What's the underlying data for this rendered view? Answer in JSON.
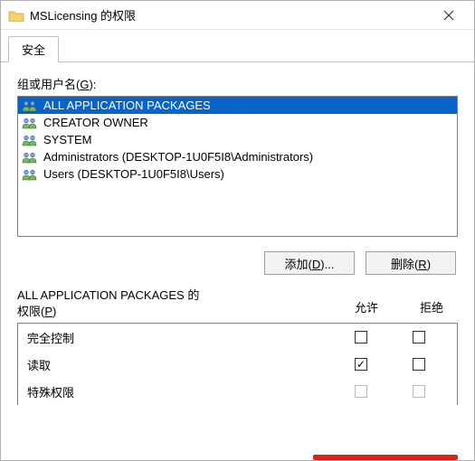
{
  "window": {
    "title": "MSLicensing 的权限"
  },
  "tabs": {
    "security": "安全"
  },
  "labels": {
    "groups_label_pre": "组或用户名(",
    "groups_hotkey": "G",
    "groups_label_post": "):",
    "add_pre": "添加(",
    "add_hotkey": "D",
    "add_post": ")...",
    "remove_pre": "删除(",
    "remove_hotkey": "R",
    "remove_post": ")",
    "perm_for_suffix": " 的",
    "perm_label_pre": "权限(",
    "perm_hotkey": "P",
    "perm_label_post": ")",
    "allow": "允许",
    "deny": "拒绝"
  },
  "principals": [
    {
      "name": "ALL APPLICATION PACKAGES",
      "selected": true
    },
    {
      "name": "CREATOR OWNER",
      "selected": false
    },
    {
      "name": "SYSTEM",
      "selected": false
    },
    {
      "name": "Administrators (DESKTOP-1U0F5I8\\Administrators)",
      "selected": false
    },
    {
      "name": "Users (DESKTOP-1U0F5I8\\Users)",
      "selected": false
    }
  ],
  "selected_principal": "ALL APPLICATION PACKAGES",
  "permissions": [
    {
      "name": "完全控制",
      "allow": false,
      "deny": false,
      "disabled": false
    },
    {
      "name": "读取",
      "allow": true,
      "deny": false,
      "disabled": false
    },
    {
      "name": "特殊权限",
      "allow": false,
      "deny": false,
      "disabled": true
    }
  ]
}
